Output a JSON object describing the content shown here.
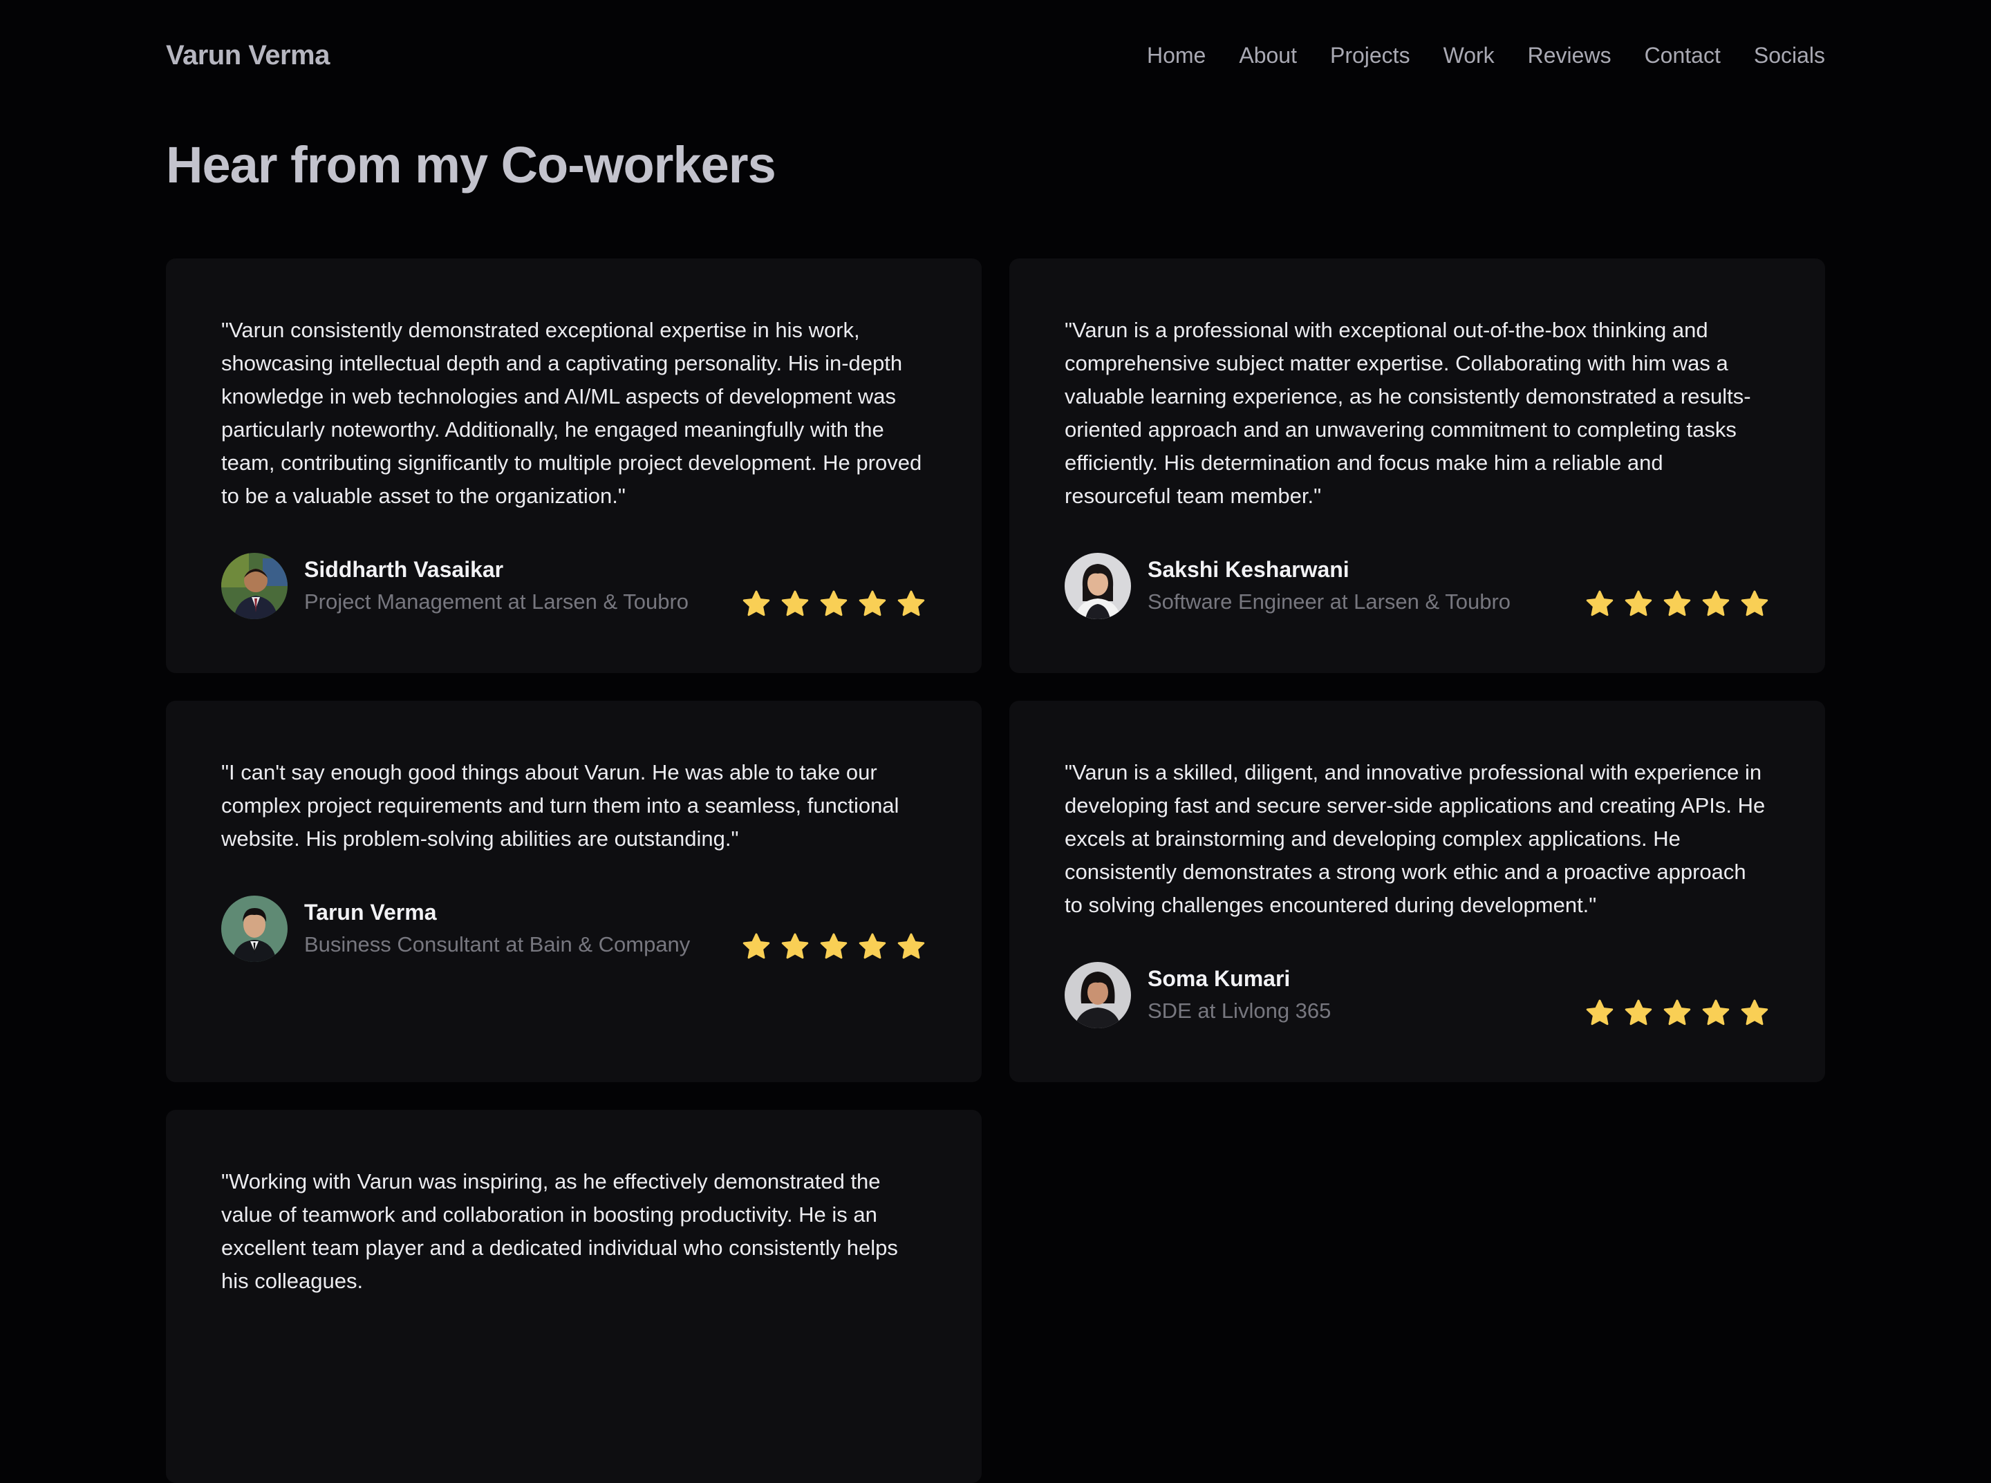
{
  "header": {
    "brand": "Varun Verma",
    "nav": [
      "Home",
      "About",
      "Projects",
      "Work",
      "Reviews",
      "Contact",
      "Socials"
    ]
  },
  "page_title": "Hear from my Co-workers",
  "colors": {
    "background": "#030305",
    "card": "#0e0e11",
    "star": "#f9cf55",
    "muted_text": "#77777f"
  },
  "reviews": [
    {
      "quote": "\"Varun consistently demonstrated exceptional expertise in his work, showcasing intellectual depth and a captivating personality. His in-depth knowledge in web technologies and AI/ML aspects of development was particularly noteworthy. Additionally, he engaged meaningfully with the team, contributing significantly to multiple project development. He proved to be a valuable asset to the organization.\"",
      "name": "Siddharth Vasaikar",
      "role": "Project Management at Larsen & Toubro",
      "rating": 5
    },
    {
      "quote": "\"Varun is a professional with exceptional out-of-the-box thinking and comprehensive subject matter expertise. Collaborating with him was a valuable learning experience, as he consistently demonstrated a results-oriented approach and an unwavering commitment to completing tasks efficiently. His determination and focus make him a reliable and resourceful team member.\"",
      "name": "Sakshi Kesharwani",
      "role": "Software Engineer at Larsen & Toubro",
      "rating": 5
    },
    {
      "quote": "\"I can't say enough good things about Varun. He was able to take our complex project requirements and turn them into a seamless, functional website. His problem-solving abilities are outstanding.\"",
      "name": "Tarun Verma",
      "role": "Business Consultant at Bain & Company",
      "rating": 5
    },
    {
      "quote": "\"Varun is a skilled, diligent, and innovative professional with experience in developing fast and secure server-side applications and creating APIs. He excels at brainstorming and developing complex applications. He consistently demonstrates a strong work ethic and a proactive approach to solving challenges encountered during development.\"",
      "name": "Soma Kumari",
      "role": "SDE at Livlong 365",
      "rating": 5
    },
    {
      "quote": "\"Working with Varun was inspiring, as he effectively demonstrated the value of teamwork and collaboration in boosting productivity. He is an excellent team player and a dedicated individual who consistently helps his colleagues."
    }
  ]
}
